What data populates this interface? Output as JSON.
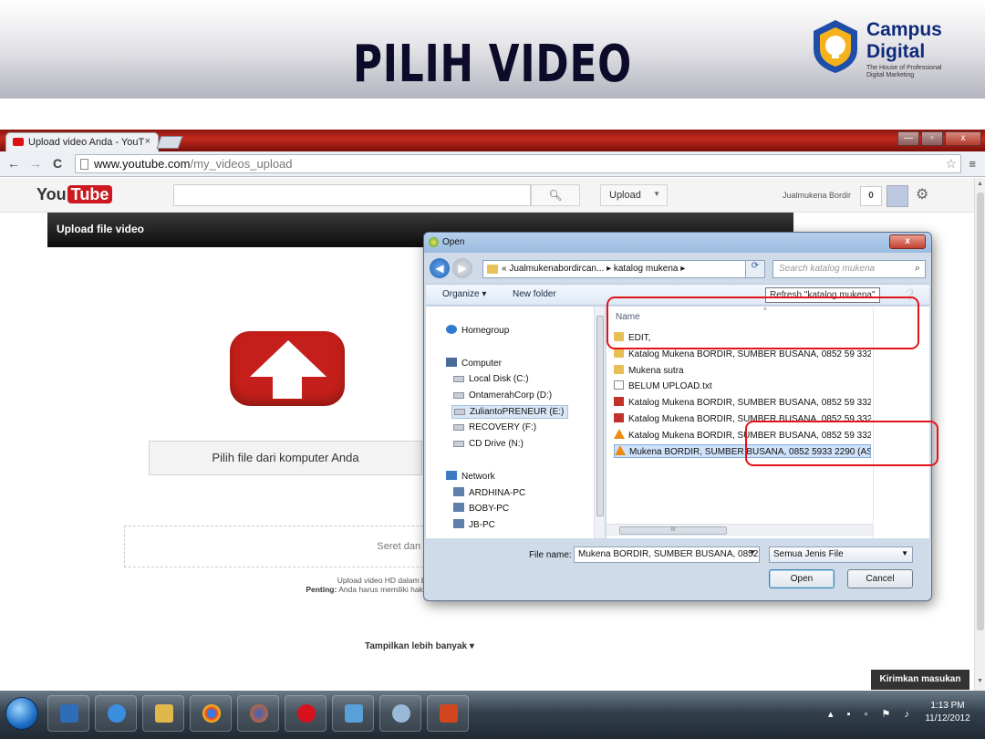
{
  "slide": {
    "title": "PILIH VIDEO",
    "logo_line1": "Campus",
    "logo_line2": "Digital",
    "logo_tagline": "The House of Professional Digital Marketing"
  },
  "browser": {
    "tab_title": "Upload video Anda - YouT",
    "tab_close": "×",
    "url_host": "www.youtube.com",
    "url_path": "/my_videos_upload",
    "back": "←",
    "forward": "→",
    "reload": "C",
    "menu": "≡",
    "win_min": "—",
    "win_max": "▫",
    "win_close": "x"
  },
  "youtube": {
    "logo_you": "You",
    "logo_tube": "Tube",
    "search_placeholder": "",
    "upload_label": "Upload",
    "account_name": "Jualmukena Bordir",
    "notif_count": "0",
    "panel_title": "Upload file video",
    "choose_file_label": "Pilih file dari komputer Anda",
    "drop_text": "Seret dan lepas video di mana pun d",
    "info_line1": "Upload video HD dalam berbagai format dengan",
    "info_line2_bold": "Penting:",
    "info_line2": "Anda harus memiliki hak cipta atau memiliki hak yang dip",
    "show_more": "Tampilkan lebih banyak",
    "feedback": "Kirimkan masukan"
  },
  "dialog": {
    "title": "Open",
    "close": "x",
    "address_path": "« Jualmukenabordircan... ▸ katalog mukena ▸",
    "search_placeholder": "Search katalog mukena",
    "toolbar_organize": "Organize ▾",
    "toolbar_new_folder": "New folder",
    "tooltip": "Refresh \"katalog mukena\"",
    "nav_items": [
      {
        "label": "Homegroup",
        "icon": "homegroup-icon"
      },
      {
        "label": "Computer",
        "icon": "computer-icon"
      },
      {
        "label": "Local Disk (C:)",
        "icon": "drive-icon"
      },
      {
        "label": "OntamerahCorp (D:)",
        "icon": "drive-icon"
      },
      {
        "label": "ZuliantoPRENEUR (E:)",
        "icon": "drive-icon"
      },
      {
        "label": "RECOVERY (F:)",
        "icon": "drive-icon"
      },
      {
        "label": "CD Drive (N:)",
        "icon": "cd-drive-icon"
      },
      {
        "label": "Network",
        "icon": "network-icon"
      },
      {
        "label": "ARDHINA-PC",
        "icon": "pc-icon"
      },
      {
        "label": "BOBY-PC",
        "icon": "pc-icon"
      },
      {
        "label": "JB-PC",
        "icon": "pc-icon"
      }
    ],
    "column_name": "Name",
    "files": [
      {
        "name": "EDIT,",
        "icon": "folder-icon"
      },
      {
        "name": "Katalog Mukena BORDIR, SUMBER BUSANA, 0852 59 3322 9",
        "icon": "folder-icon"
      },
      {
        "name": "Mukena sutra",
        "icon": "folder-icon"
      },
      {
        "name": "BELUM UPLOAD.txt",
        "icon": "text-file-icon"
      },
      {
        "name": "Katalog Mukena BORDIR, SUMBER BUSANA, 0852 59 3322 9",
        "icon": "document-icon"
      },
      {
        "name": "Katalog Mukena BORDIR, SUMBER BUSANA, 0852 59 3322 9",
        "icon": "document-icon"
      },
      {
        "name": "Katalog Mukena BORDIR, SUMBER BUSANA, 0852 59 3322 9",
        "icon": "vlc-icon"
      },
      {
        "name": "Mukena BORDIR, SUMBER BUSANA, 0852 5933 2290 (AS).wr",
        "icon": "vlc-icon"
      }
    ],
    "scroll_grip": "III",
    "file_name_label": "File name:",
    "file_name_value": "Mukena BORDIR, SUMBER BUSANA, 0852",
    "file_type": "Semua Jenis File",
    "open_label": "Open",
    "cancel_label": "Cancel"
  },
  "taskbar": {
    "time": "1:13 PM",
    "date": "11/12/2012",
    "apps": [
      "windows-explorer-icon",
      "internet-explorer-icon",
      "folder-icon",
      "chrome-icon",
      "firefox-icon",
      "opera-icon",
      "notepad-icon",
      "paint-icon",
      "powerpoint-icon"
    ]
  },
  "colors": {
    "accent_red": "#e4131a",
    "youtube_red": "#cc181e",
    "title_navy": "#0c0c2a",
    "logo_blue": "#0f2a7a"
  }
}
